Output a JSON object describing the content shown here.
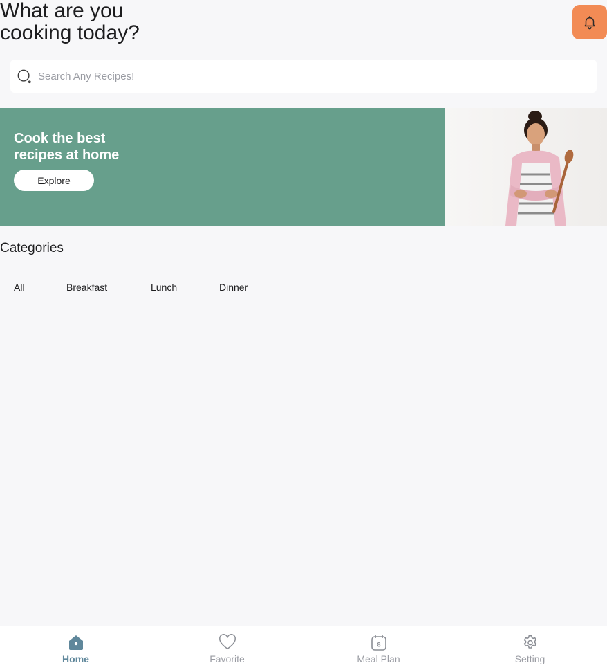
{
  "header": {
    "title": "What are you cooking today?",
    "notification_icon": "bell-icon",
    "accent_color": "#f28b55"
  },
  "search": {
    "placeholder": "Search Any Recipes!",
    "value": "",
    "icon": "search-icon"
  },
  "hero": {
    "title": "Cook the best recipes at home",
    "button_label": "Explore",
    "background_color": "#679f8c",
    "image": "woman-chef-photo"
  },
  "categories": {
    "heading": "Categories",
    "tabs": [
      {
        "label": "All"
      },
      {
        "label": "Breakfast"
      },
      {
        "label": "Lunch"
      },
      {
        "label": "Dinner"
      }
    ]
  },
  "bottom_nav": {
    "items": [
      {
        "label": "Home",
        "icon": "home-icon",
        "active": true
      },
      {
        "label": "Favorite",
        "icon": "heart-icon",
        "active": false
      },
      {
        "label": "Meal Plan",
        "icon": "calendar-icon",
        "active": false,
        "badge": "8"
      },
      {
        "label": "Setting",
        "icon": "gear-icon",
        "active": false
      }
    ],
    "active_color": "#5f879b"
  }
}
